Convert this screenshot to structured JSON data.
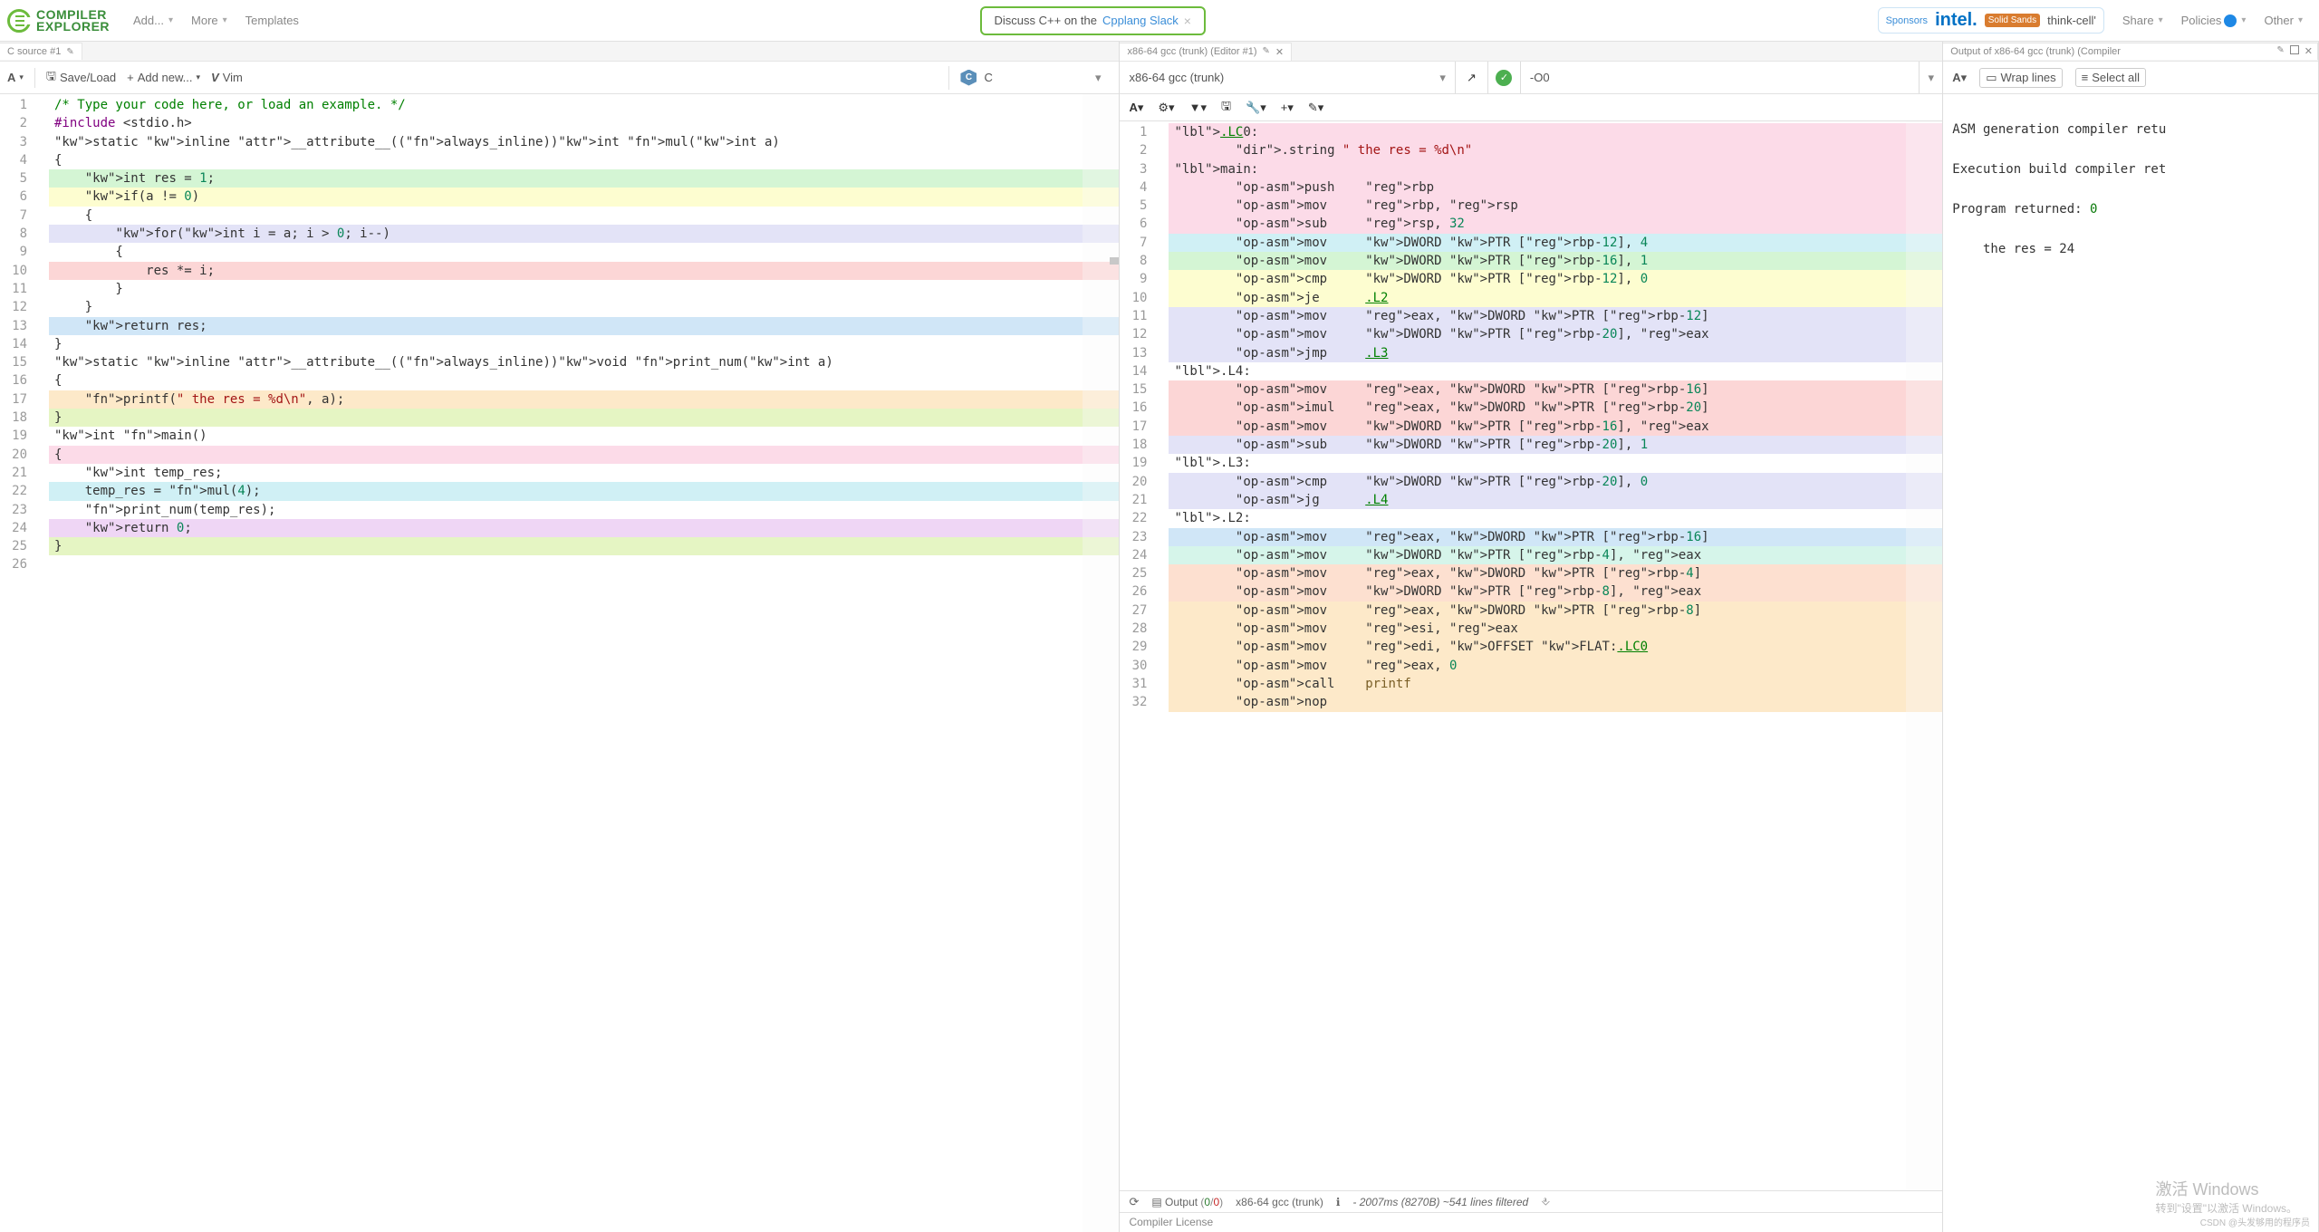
{
  "nav": {
    "add": "Add...",
    "more": "More",
    "templates": "Templates",
    "share": "Share",
    "policies": "Policies",
    "other": "Other"
  },
  "logo": {
    "line1": "COMPILER",
    "line2": "EXPLORER"
  },
  "banner": {
    "text": "Discuss C++ on the ",
    "link": "Cpplang Slack"
  },
  "sponsors": {
    "label": "Sponsors",
    "intel": "intel.",
    "solid": "Solid Sands",
    "thinkcell": "think-cell'"
  },
  "leftTab": {
    "title": "C source #1"
  },
  "leftToolbar": {
    "font": "A",
    "saveload": "Save/Load",
    "addnew": "Add new...",
    "vim": "Vim"
  },
  "lang": {
    "name": "C"
  },
  "sourceLines": [
    [
      "",
      "/* Type your code here, or load an example. */"
    ],
    [
      "",
      "#include <stdio.h>"
    ],
    [
      "",
      "static inline __attribute__((always_inline))int mul(int a)"
    ],
    [
      "",
      "{"
    ],
    [
      "bg-green",
      "    int res = 1;"
    ],
    [
      "bg-yellow",
      "    if(a != 0)"
    ],
    [
      "",
      "    {"
    ],
    [
      "bg-lav",
      "        for(int i = a; i > 0; i--)"
    ],
    [
      "",
      "        {"
    ],
    [
      "bg-red",
      "            res *= i;"
    ],
    [
      "",
      "        }"
    ],
    [
      "",
      "    }"
    ],
    [
      "bg-blue",
      "    return res;"
    ],
    [
      "",
      "}"
    ],
    [
      "",
      "static inline __attribute__((always_inline))void print_num(int a)"
    ],
    [
      "",
      "{"
    ],
    [
      "bg-orange",
      "    printf(\" the res = %d\\n\", a);"
    ],
    [
      "bg-lime",
      "}"
    ],
    [
      "",
      "int main()"
    ],
    [
      "bg-pink",
      "{"
    ],
    [
      "",
      "    int temp_res;"
    ],
    [
      "bg-cyan",
      "    temp_res = mul(4);"
    ],
    [
      "",
      "    print_num(temp_res);"
    ],
    [
      "bg-purple",
      "    return 0;"
    ],
    [
      "bg-lime",
      "}"
    ],
    [
      "",
      ""
    ]
  ],
  "midTab": {
    "title": "x86-64 gcc (trunk) (Editor #1)"
  },
  "compiler": {
    "name": "x86-64 gcc (trunk)",
    "opts": "-O0"
  },
  "asmLines": [
    [
      "bg-pink",
      ".LC0:"
    ],
    [
      "bg-pink",
      "        .string \" the res = %d\\n\""
    ],
    [
      "bg-pink",
      "main:"
    ],
    [
      "bg-pink",
      "        push    rbp"
    ],
    [
      "bg-pink",
      "        mov     rbp, rsp"
    ],
    [
      "bg-pink",
      "        sub     rsp, 32"
    ],
    [
      "bg-cyan",
      "        mov     DWORD PTR [rbp-12], 4"
    ],
    [
      "bg-green",
      "        mov     DWORD PTR [rbp-16], 1"
    ],
    [
      "bg-yellow",
      "        cmp     DWORD PTR [rbp-12], 0"
    ],
    [
      "bg-yellow",
      "        je      .L2"
    ],
    [
      "bg-lav",
      "        mov     eax, DWORD PTR [rbp-12]"
    ],
    [
      "bg-lav",
      "        mov     DWORD PTR [rbp-20], eax"
    ],
    [
      "bg-lav",
      "        jmp     .L3"
    ],
    [
      "",
      ".L4:"
    ],
    [
      "bg-red",
      "        mov     eax, DWORD PTR [rbp-16]"
    ],
    [
      "bg-red",
      "        imul    eax, DWORD PTR [rbp-20]"
    ],
    [
      "bg-red",
      "        mov     DWORD PTR [rbp-16], eax"
    ],
    [
      "bg-lav",
      "        sub     DWORD PTR [rbp-20], 1"
    ],
    [
      "",
      ".L3:"
    ],
    [
      "bg-lav",
      "        cmp     DWORD PTR [rbp-20], 0"
    ],
    [
      "bg-lav",
      "        jg      .L4"
    ],
    [
      "",
      ".L2:"
    ],
    [
      "bg-blue",
      "        mov     eax, DWORD PTR [rbp-16]"
    ],
    [
      "bg-mint",
      "        mov     DWORD PTR [rbp-4], eax"
    ],
    [
      "bg-peach",
      "        mov     eax, DWORD PTR [rbp-4]"
    ],
    [
      "bg-peach",
      "        mov     DWORD PTR [rbp-8], eax"
    ],
    [
      "bg-orange",
      "        mov     eax, DWORD PTR [rbp-8]"
    ],
    [
      "bg-orange",
      "        mov     esi, eax"
    ],
    [
      "bg-orange",
      "        mov     edi, OFFSET FLAT:.LC0"
    ],
    [
      "bg-orange",
      "        mov     eax, 0"
    ],
    [
      "bg-orange",
      "        call    printf"
    ],
    [
      "bg-orange",
      "        nop"
    ]
  ],
  "bottom": {
    "output": "Output",
    "counts": "(0/0)",
    "compiler": "x86-64 gcc (trunk)",
    "stats": "- 2007ms (8270B) ~541 lines filtered",
    "license": "Compiler License"
  },
  "rightTab": {
    "title": "Output of x86-64 gcc (trunk) (Compiler"
  },
  "rightToolbar": {
    "font": "A",
    "wrap": "Wrap lines",
    "selectall": "Select all"
  },
  "output": {
    "l1": "ASM generation compiler retu",
    "l2": "Execution build compiler ret",
    "l3": "Program returned: ",
    "l3v": "0",
    "l4": "    the res = 24"
  },
  "watermark": {
    "big": "激活 Windows",
    "small": "转到\"设置\"以激活 Windows。",
    "csdn": "CSDN @头发够用的程序员"
  }
}
